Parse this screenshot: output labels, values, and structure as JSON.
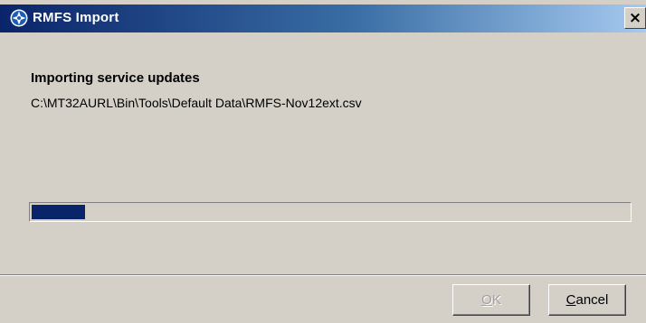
{
  "window": {
    "title": "RMFS Import",
    "close_glyph": "×",
    "icon": "rmfs-app-icon",
    "titlebar_color": "#0a246a"
  },
  "main": {
    "heading": "Importing service updates",
    "file_path": "C:\\MT32AURL\\Bin\\Tools\\Default Data\\RMFS-Nov12ext.csv",
    "progress_fraction": 0.09,
    "progress_color": "#0a246a"
  },
  "buttons": {
    "ok": {
      "mnemonic": "O",
      "rest": "K",
      "enabled": false
    },
    "cancel": {
      "mnemonic": "C",
      "rest": "ancel",
      "enabled": true
    }
  }
}
